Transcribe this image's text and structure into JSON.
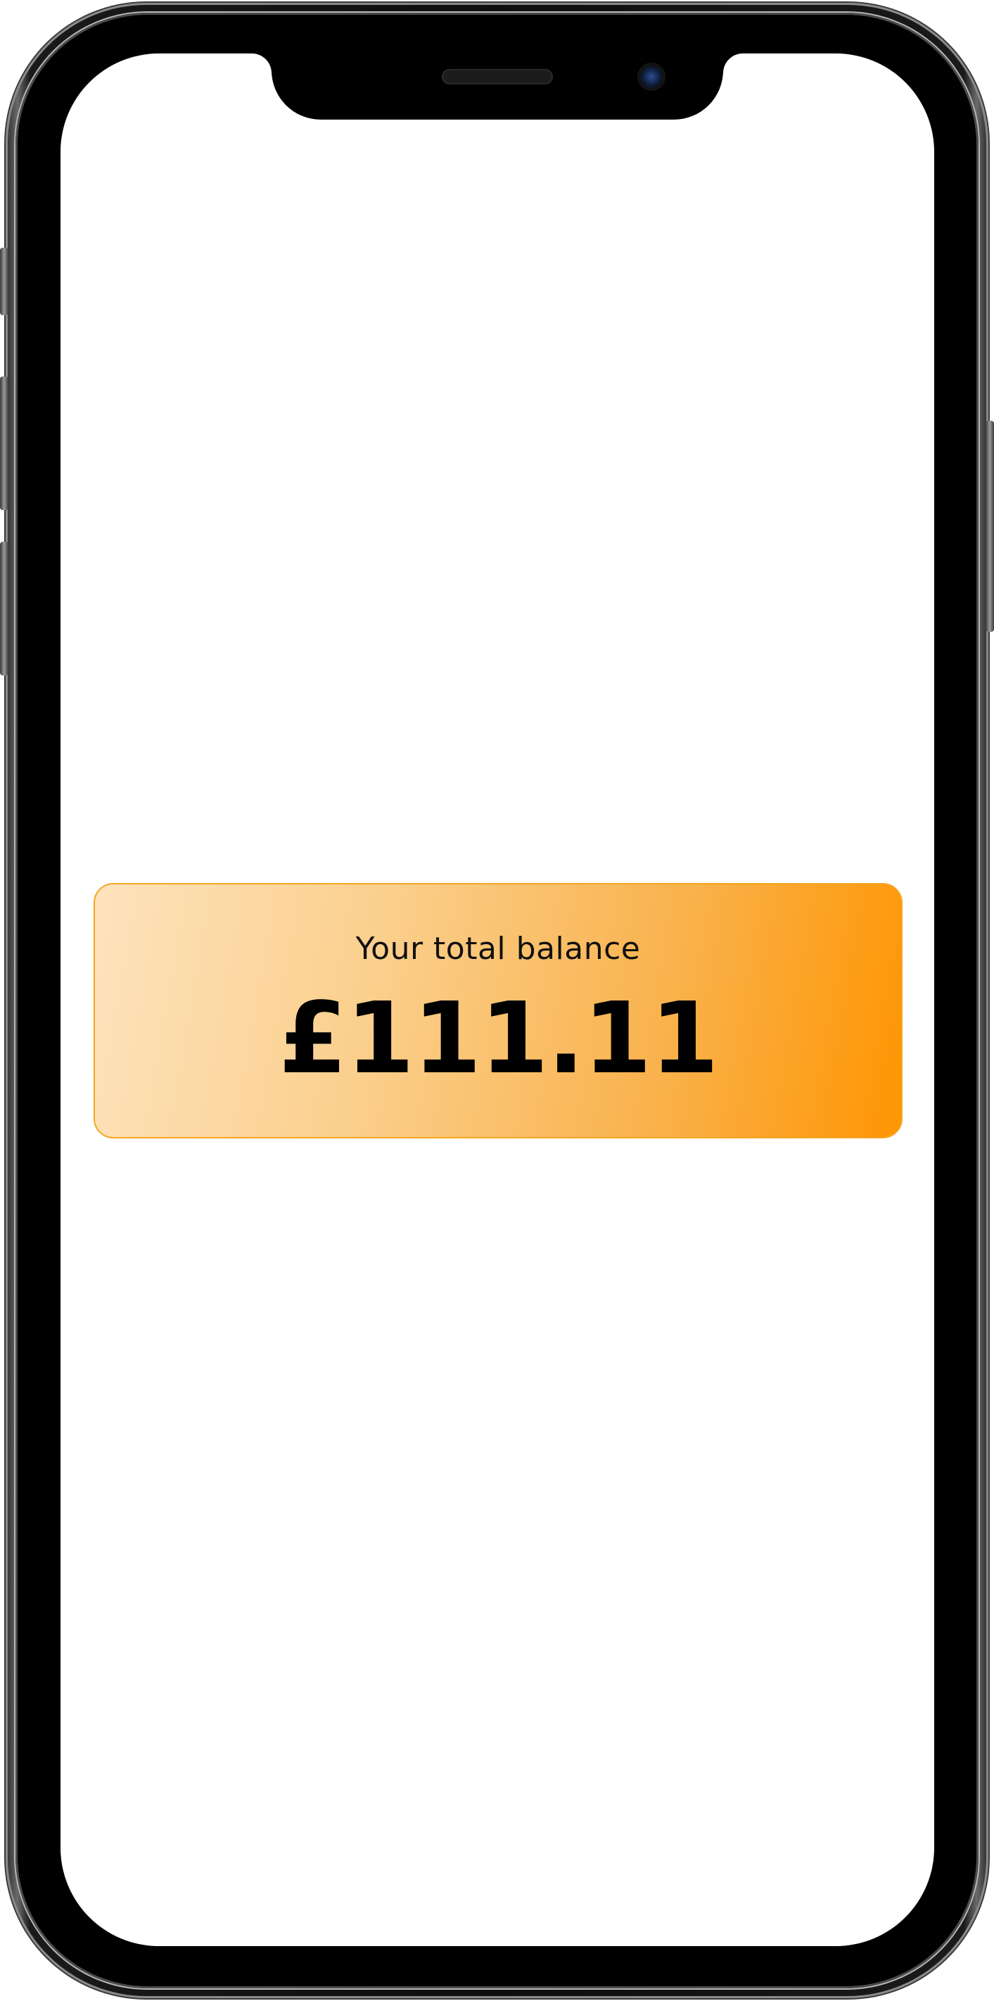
{
  "balance_card": {
    "label": "Your total balance",
    "amount": "£111.11",
    "gradient_start_color": "#fde3bd",
    "gradient_end_color": "#ff9502",
    "border_color": "#f5a623"
  },
  "device": {
    "frame_color": "#0d0d0d",
    "screen_color": "#ffffff"
  }
}
